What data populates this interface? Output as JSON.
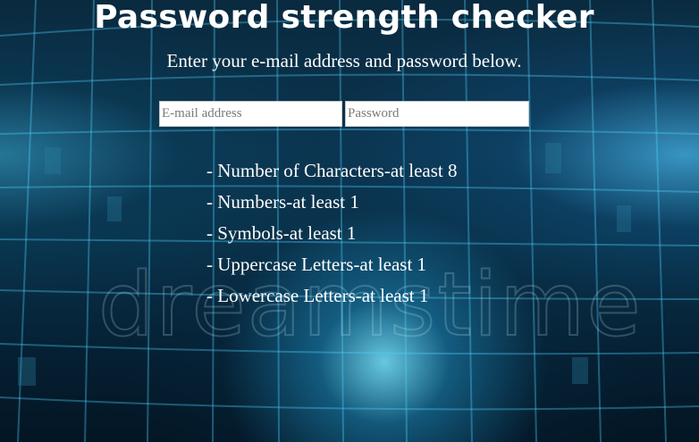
{
  "header": {
    "title": "Password strength checker",
    "subtitle": "Enter your e-mail address and password below."
  },
  "form": {
    "email_placeholder": "E-mail address",
    "email_value": "",
    "password_placeholder": "Password",
    "password_value": ""
  },
  "requirements": [
    "- Number of Characters-at least 8",
    "- Numbers-at least 1",
    "- Symbols-at least 1",
    "- Uppercase Letters-at least 1",
    "- Lowercase Letters-at least 1"
  ],
  "background": {
    "watermark": "dreamstime",
    "colors": {
      "base": "#0b3550",
      "glow": "#78e6ff",
      "grid_line": "#4fd3ff"
    }
  }
}
